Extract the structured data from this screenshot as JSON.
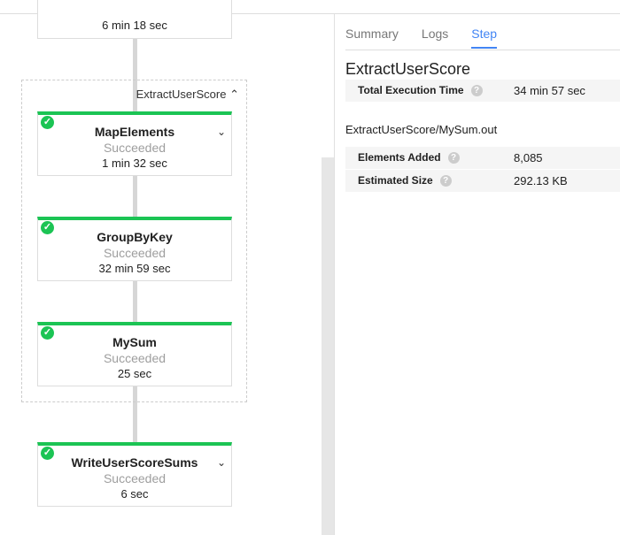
{
  "graph": {
    "prev_card_time": "6 min 18 sec",
    "group": {
      "label": "ExtractUserScore",
      "toggle_icon": "chevron-up-icon"
    },
    "steps": [
      {
        "name": "MapElements",
        "status": "Succeeded",
        "time": "1 min 32 sec"
      },
      {
        "name": "GroupByKey",
        "status": "Succeeded",
        "time": "32 min 59 sec"
      },
      {
        "name": "MySum",
        "status": "Succeeded",
        "time": "25 sec"
      },
      {
        "name": "WriteUserScoreSums",
        "status": "Succeeded",
        "time": "6 sec"
      }
    ],
    "success_color": "#1bc454"
  },
  "panel": {
    "tabs": [
      "Summary",
      "Logs",
      "Step"
    ],
    "active_tab": "Step",
    "title": "ExtractUserScore",
    "total_execution_time": {
      "label": "Total Execution Time",
      "value": "34 min 57 sec"
    },
    "section": "ExtractUserScore/MySum.out",
    "metrics": [
      {
        "label": "Elements Added",
        "value": "8,085"
      },
      {
        "label": "Estimated Size",
        "value": "292.13 KB"
      }
    ],
    "accent": "#4285f4"
  }
}
